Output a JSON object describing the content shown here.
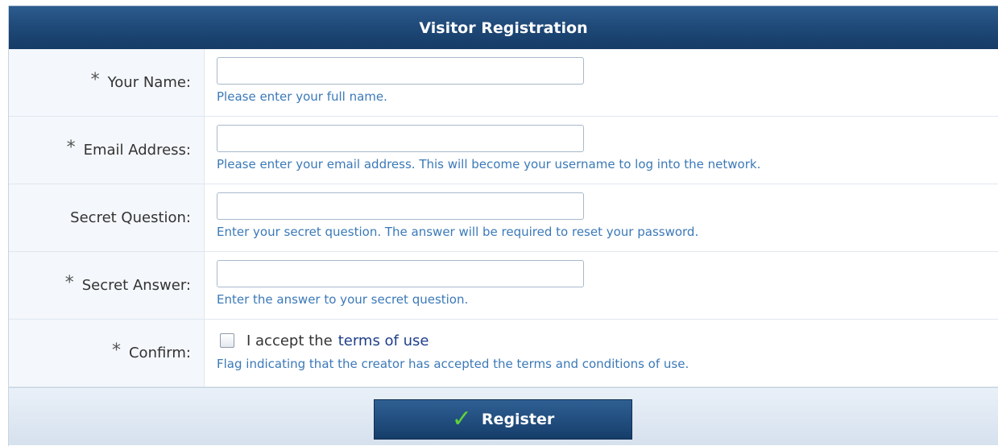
{
  "form": {
    "title": "Visitor Registration",
    "fields": [
      {
        "required_mark": "*",
        "label": "Your Name:",
        "value": "",
        "hint": "Please enter your full name."
      },
      {
        "required_mark": "*",
        "label": "Email Address:",
        "value": "",
        "hint": "Please enter your email address. This will become your username to log into the network."
      },
      {
        "required_mark": "",
        "label": "Secret Question:",
        "value": "",
        "hint": "Enter your secret question. The answer will be required to reset your password."
      },
      {
        "required_mark": "*",
        "label": "Secret Answer:",
        "value": "",
        "hint": "Enter the answer to your secret question."
      }
    ],
    "confirm": {
      "required_mark": "*",
      "label": "Confirm:",
      "checked": false,
      "text": "I accept the",
      "link_text": "terms of use",
      "hint": "Flag indicating that the creator has accepted the terms and conditions of use."
    },
    "register_button": {
      "label": "Register",
      "icon": "checkmark-icon"
    }
  },
  "colors": {
    "header_bg": "#1f4a79",
    "hint_text": "#3b79b8",
    "link_text": "#1f3f8a",
    "check_icon": "#5fd13b"
  }
}
